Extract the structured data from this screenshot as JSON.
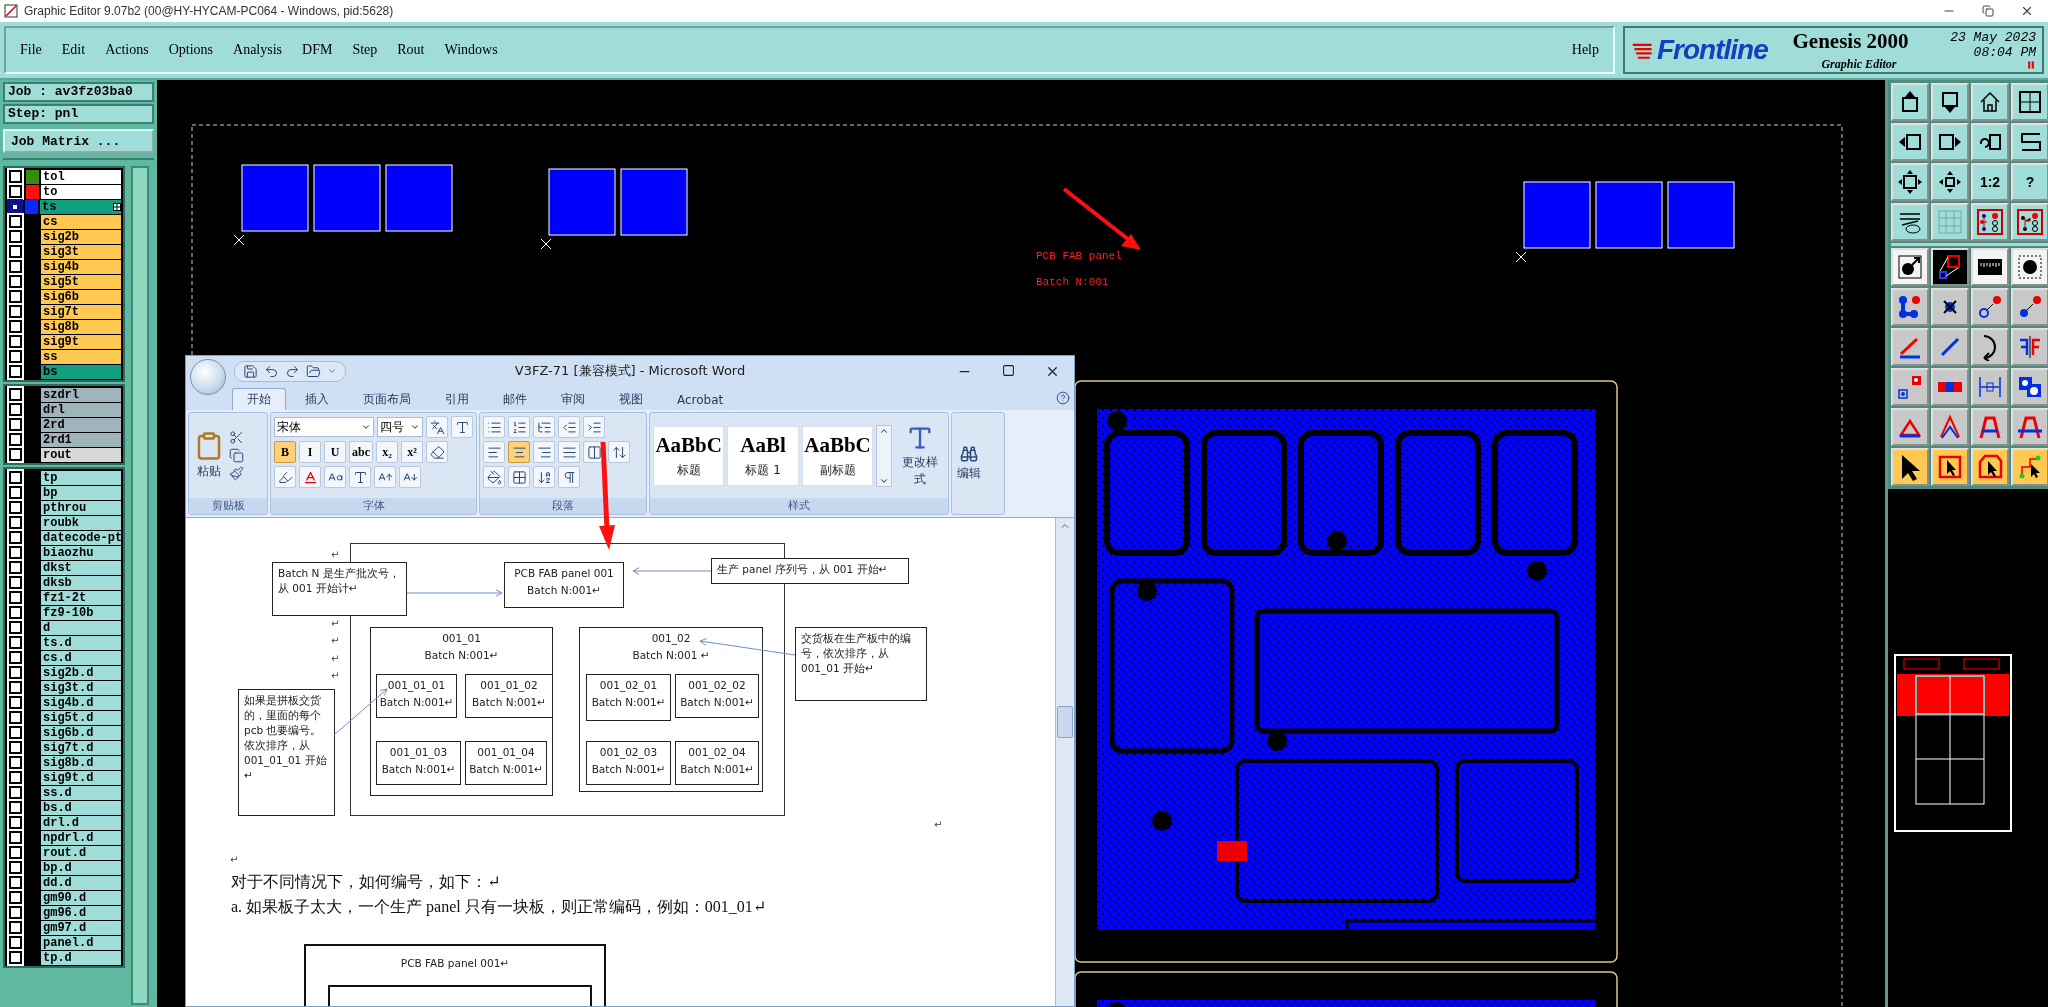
{
  "title_bar": {
    "title": "Graphic Editor 9.07b2 (00@HY-HYCAM-PC064 - Windows, pid:5628)"
  },
  "menu": [
    "File",
    "Edit",
    "Actions",
    "Options",
    "Analysis",
    "DFM",
    "Step",
    "Rout",
    "Windows"
  ],
  "help": "Help",
  "brand": {
    "logo": "Frontline",
    "product": "Genesis 2000",
    "module": "Graphic Editor",
    "date": "23 May 2023",
    "time": "08:04 PM"
  },
  "job": {
    "job": "Job : av3fz03ba0",
    "step": "Step: pnl",
    "matrix_button": "Job Matrix ..."
  },
  "layer_groups": [
    {
      "layers": [
        {
          "name": "tol",
          "kind": "silk",
          "color": "#3a8a10",
          "selected": false
        },
        {
          "name": "to",
          "kind": "silk",
          "color": "#ff1010",
          "selected": false
        },
        {
          "name": "ts",
          "kind": "mask",
          "color": "#0a28ff",
          "selected": true
        },
        {
          "name": "cs",
          "kind": "signal",
          "selected": false
        },
        {
          "name": "sig2b",
          "kind": "signal",
          "selected": false
        },
        {
          "name": "sig3t",
          "kind": "signal",
          "selected": false
        },
        {
          "name": "sig4b",
          "kind": "signal",
          "selected": false
        },
        {
          "name": "sig5t",
          "kind": "signal",
          "selected": false
        },
        {
          "name": "sig6b",
          "kind": "signal",
          "selected": false
        },
        {
          "name": "sig7t",
          "kind": "signal",
          "selected": false
        },
        {
          "name": "sig8b",
          "kind": "signal",
          "selected": false
        },
        {
          "name": "sig9t",
          "kind": "signal",
          "selected": false
        },
        {
          "name": "ss",
          "kind": "signal",
          "selected": false
        },
        {
          "name": "bs",
          "kind": "mask",
          "selected": false
        }
      ]
    },
    {
      "layers": [
        {
          "name": "szdrl",
          "kind": "drill",
          "selected": false
        },
        {
          "name": "drl",
          "kind": "drill",
          "selected": false
        },
        {
          "name": "2rd",
          "kind": "drill",
          "selected": false
        },
        {
          "name": "2rd1",
          "kind": "drill",
          "selected": false
        },
        {
          "name": "rout",
          "kind": "rout",
          "selected": false
        }
      ]
    },
    {
      "layers": [
        {
          "name": "tp",
          "kind": "misc",
          "selected": false
        },
        {
          "name": "bp",
          "kind": "misc",
          "selected": false
        },
        {
          "name": "pthrou",
          "kind": "misc",
          "selected": false
        },
        {
          "name": "roubk",
          "kind": "misc",
          "selected": false
        },
        {
          "name": "datecode-pt",
          "kind": "misc",
          "selected": false
        },
        {
          "name": "biaozhu",
          "kind": "misc",
          "selected": false
        },
        {
          "name": "dkst",
          "kind": "misc",
          "selected": false
        },
        {
          "name": "dksb",
          "kind": "misc",
          "selected": false
        },
        {
          "name": "fz1-2t",
          "kind": "misc",
          "selected": false
        },
        {
          "name": "fz9-10b",
          "kind": "misc",
          "selected": false
        },
        {
          "name": "d",
          "kind": "misc",
          "selected": false
        },
        {
          "name": "ts.d",
          "kind": "misc",
          "selected": false
        },
        {
          "name": "cs.d",
          "kind": "misc",
          "selected": false
        },
        {
          "name": "sig2b.d",
          "kind": "misc",
          "selected": false
        },
        {
          "name": "sig3t.d",
          "kind": "misc",
          "selected": false
        },
        {
          "name": "sig4b.d",
          "kind": "misc",
          "selected": false
        },
        {
          "name": "sig5t.d",
          "kind": "misc",
          "selected": false
        },
        {
          "name": "sig6b.d",
          "kind": "misc",
          "selected": false
        },
        {
          "name": "sig7t.d",
          "kind": "misc",
          "selected": false
        },
        {
          "name": "sig8b.d",
          "kind": "misc",
          "selected": false
        },
        {
          "name": "sig9t.d",
          "kind": "misc",
          "selected": false
        },
        {
          "name": "ss.d",
          "kind": "misc",
          "selected": false
        },
        {
          "name": "bs.d",
          "kind": "misc",
          "selected": false
        },
        {
          "name": "drl.d",
          "kind": "misc",
          "selected": false
        },
        {
          "name": "npdrl.d",
          "kind": "misc",
          "selected": false
        },
        {
          "name": "rout.d",
          "kind": "misc",
          "selected": false
        },
        {
          "name": "bp.d",
          "kind": "misc",
          "selected": false
        },
        {
          "name": "dd.d",
          "kind": "misc",
          "selected": false
        },
        {
          "name": "gm90.d",
          "kind": "misc",
          "selected": false
        },
        {
          "name": "gm96.d",
          "kind": "misc",
          "selected": false
        },
        {
          "name": "gm97.d",
          "kind": "misc",
          "selected": false
        },
        {
          "name": "panel.d",
          "kind": "misc",
          "selected": false
        },
        {
          "name": "tp.d",
          "kind": "misc",
          "selected": false
        }
      ]
    }
  ],
  "canvas_labels": [
    "PCB FAB panel",
    "Batch N:001"
  ],
  "toolbar": {
    "scale": "1:2",
    "help": "?"
  },
  "word": {
    "title": "V3FZ-71 [兼容模式] - Microsoft Word",
    "tabs": [
      {
        "label": "开始",
        "selected": true
      },
      {
        "label": "插入",
        "selected": false
      },
      {
        "label": "页面布局",
        "selected": false
      },
      {
        "label": "引用",
        "selected": false
      },
      {
        "label": "邮件",
        "selected": false
      },
      {
        "label": "审阅",
        "selected": false
      },
      {
        "label": "视图",
        "selected": false
      },
      {
        "label": "Acrobat",
        "selected": false
      }
    ],
    "paste": "粘贴",
    "font": "宋体",
    "size": "四号",
    "format_buttons": [
      {
        "label": "B",
        "selected": true
      },
      {
        "label": "I",
        "selected": false
      },
      {
        "label": "U",
        "selected": false
      },
      {
        "label": "abc",
        "selected": false
      },
      {
        "label": "x₂",
        "selected": false
      },
      {
        "label": "x²",
        "selected": false
      }
    ],
    "align_buttons": [
      {
        "selected": false
      },
      {
        "selected": true
      },
      {
        "selected": false
      },
      {
        "selected": false
      }
    ],
    "styles": [
      {
        "sample": "AaBbC",
        "label": "标题"
      },
      {
        "sample": "AaBl",
        "label": "标题 1"
      },
      {
        "sample": "AaBbC",
        "label": "副标题"
      }
    ],
    "change_styles": "更改样式",
    "edit": "编辑",
    "groups": [
      "剪贴板",
      "字体",
      "段落",
      "样式"
    ],
    "document": {
      "boxes": [
        {
          "lines": [
            "Batch  N  是生产批次号，从 001 开始计↵"
          ]
        },
        {
          "lines": [
            "PCB FAB panel 001",
            "Batch N:001↵"
          ]
        },
        {
          "lines": [
            "生产 panel  序列号，从 001 开始↵"
          ]
        },
        {
          "lines": [
            "001_01",
            "Batch N:001↵"
          ]
        },
        {
          "lines": [
            "001_02",
            "Batch N:001 ↵"
          ]
        },
        {
          "lines": [
            "交货板在生产板中的编号，依次排序，从 001_01 开始↵"
          ]
        },
        {
          "lines": [
            "如果是拼板交货的，里面的每个 pcb 也要编号。依次排序，从 001_01_01 开始↵"
          ]
        },
        {
          "lines": [
            "001_01_01",
            "Batch N:001↵"
          ]
        },
        {
          "lines": [
            "001_01_02",
            "Batch N:001↵"
          ]
        },
        {
          "lines": [
            "001_01_03",
            "Batch N:001↵"
          ]
        },
        {
          "lines": [
            "001_01_04",
            "Batch N:001↵"
          ]
        },
        {
          "lines": [
            "001_02_01",
            "Batch N:001↵"
          ]
        },
        {
          "lines": [
            "001_02_02",
            "Batch N:001↵"
          ]
        },
        {
          "lines": [
            "001_02_03",
            "Batch N:001↵"
          ]
        },
        {
          "lines": [
            "001_02_04",
            "Batch N:001↵"
          ]
        }
      ],
      "marks": [
        "↵",
        "↵",
        "↵",
        "↵",
        "↵",
        "↵",
        "↵"
      ],
      "paragraphs": [
        "对于不同情况下，如何编号，如下：↵",
        "a.   如果板子太大，一个生产 panel 只有一块板，则正常编码，例如：001_01↵"
      ],
      "bottom_box": "PCB FAB panel 001↵"
    }
  }
}
